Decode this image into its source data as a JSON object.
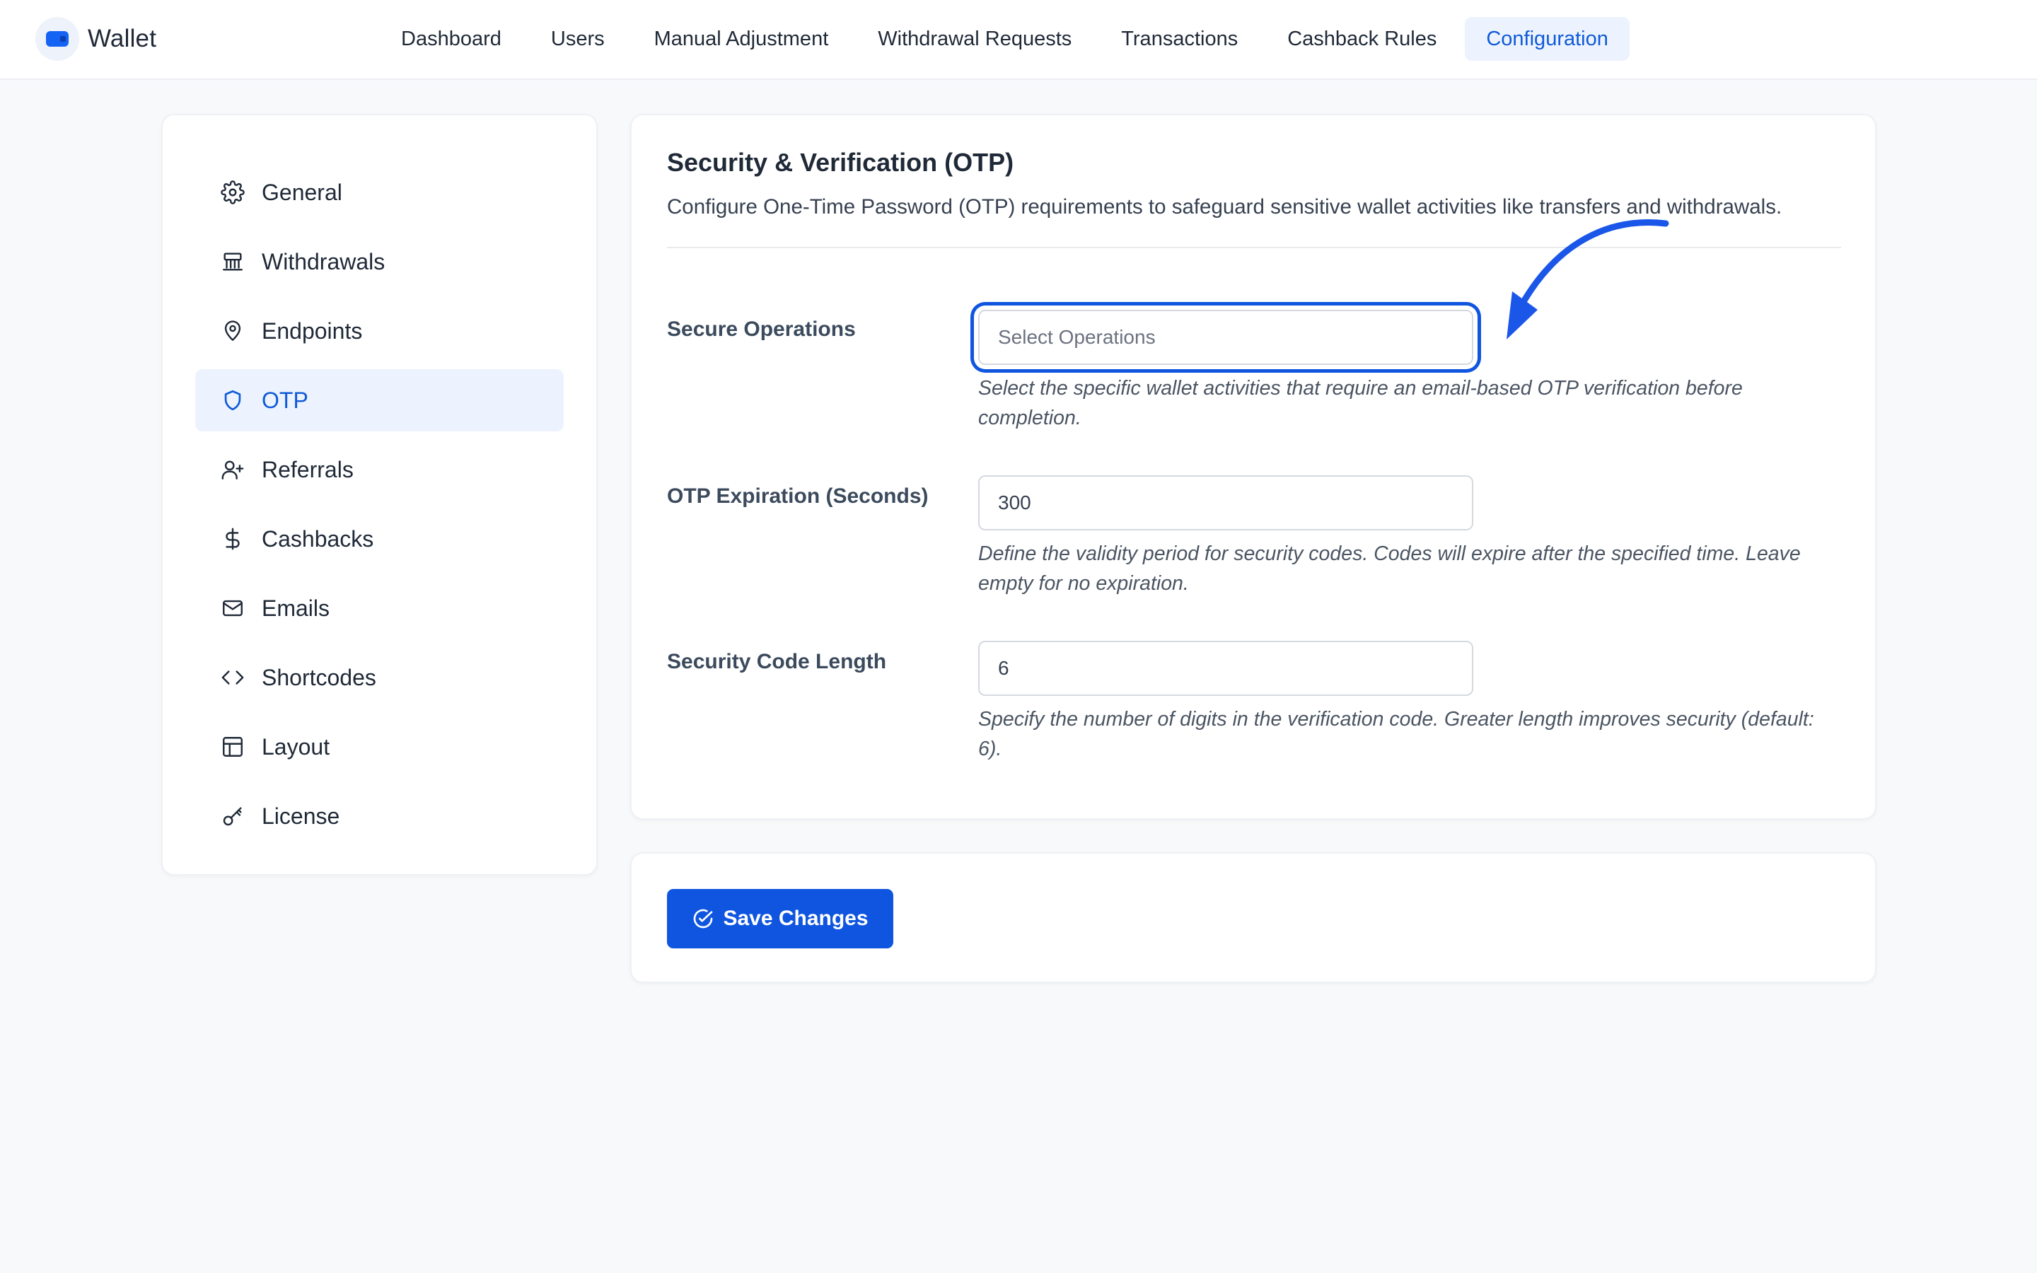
{
  "app": {
    "name": "Wallet"
  },
  "topnav": [
    {
      "label": "Dashboard",
      "active": false
    },
    {
      "label": "Users",
      "active": false
    },
    {
      "label": "Manual Adjustment",
      "active": false
    },
    {
      "label": "Withdrawal Requests",
      "active": false
    },
    {
      "label": "Transactions",
      "active": false
    },
    {
      "label": "Cashback Rules",
      "active": false
    },
    {
      "label": "Configuration",
      "active": true
    }
  ],
  "sidebar": {
    "items": [
      {
        "label": "General",
        "icon": "gear-icon",
        "active": false
      },
      {
        "label": "Withdrawals",
        "icon": "bank-icon",
        "active": false
      },
      {
        "label": "Endpoints",
        "icon": "map-pin-icon",
        "active": false
      },
      {
        "label": "OTP",
        "icon": "shield-icon",
        "active": true
      },
      {
        "label": "Referrals",
        "icon": "user-plus-icon",
        "active": false
      },
      {
        "label": "Cashbacks",
        "icon": "dollar-icon",
        "active": false
      },
      {
        "label": "Emails",
        "icon": "mail-icon",
        "active": false
      },
      {
        "label": "Shortcodes",
        "icon": "code-icon",
        "active": false
      },
      {
        "label": "Layout",
        "icon": "layout-icon",
        "active": false
      },
      {
        "label": "License",
        "icon": "key-icon",
        "active": false
      }
    ]
  },
  "section": {
    "title": "Security & Verification (OTP)",
    "description": "Configure One-Time Password (OTP) requirements to safeguard sensitive wallet activities like transfers and withdrawals."
  },
  "fields": {
    "secure_operations": {
      "label": "Secure Operations",
      "value": "",
      "placeholder": "Select Operations",
      "help": "Select the specific wallet activities that require an email-based OTP verification before completion."
    },
    "otp_expiration": {
      "label": "OTP Expiration (Seconds)",
      "value": "300",
      "placeholder": "",
      "help": "Define the validity period for security codes. Codes will expire after the specified time. Leave empty for no expiration."
    },
    "code_length": {
      "label": "Security Code Length",
      "value": "6",
      "placeholder": "",
      "help": "Specify the number of digits in the verification code. Greater length improves security (default: 6)."
    }
  },
  "actions": {
    "save_label": "Save Changes",
    "save_icon": "check-circle-icon"
  },
  "colors": {
    "accent": "#0f55e0",
    "active_bg": "#edf3fe",
    "annotation": "#1a56e8"
  }
}
